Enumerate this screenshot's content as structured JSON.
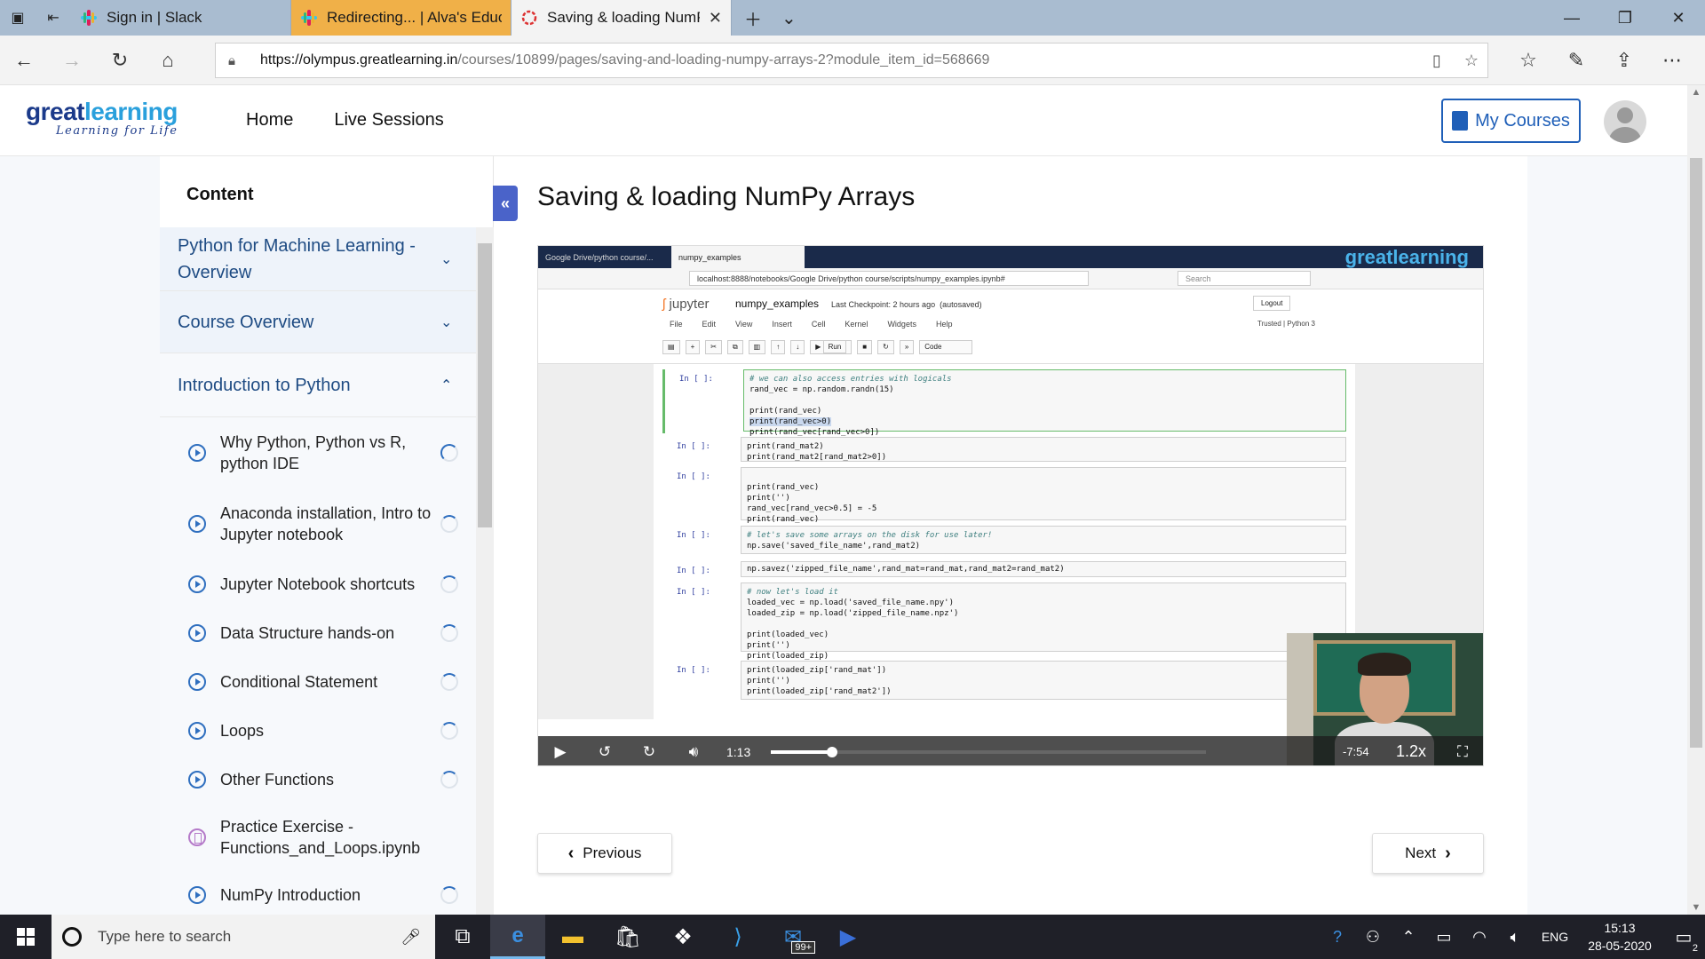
{
  "browser": {
    "tabs": [
      {
        "label": "Sign in | Slack",
        "state": "inactive"
      },
      {
        "label": "Redirecting... | Alva's Educat",
        "state": "inactive-highlight"
      },
      {
        "label": "Saving & loading NumP",
        "state": "active"
      }
    ],
    "url": {
      "host": "https://olympus.greatlearning.in",
      "path": "/courses/10899/pages/saving-and-loading-numpy-arrays-2?module_item_id=568669"
    },
    "icons": {
      "tab_actions": [
        "plus-icon",
        "chevron-down-icon"
      ],
      "window_controls": [
        "minimize-icon",
        "restore-icon",
        "close-icon"
      ],
      "nav": [
        "back-arrow-icon",
        "forward-arrow-icon",
        "refresh-icon",
        "home-icon"
      ],
      "right": [
        "favorites-icon",
        "pen-icon",
        "share-icon",
        "more-icon"
      ]
    }
  },
  "site": {
    "logo": {
      "great": "great",
      "learning": "learning",
      "tagline": "Learning for Life"
    },
    "nav": [
      "Home",
      "Live Sessions"
    ],
    "my_courses_label": "My Courses",
    "brand_color": "#1f5fb8"
  },
  "sidebar": {
    "title": "Content",
    "sections": [
      {
        "title": "Python for Machine Learning - Overview",
        "expanded": false
      },
      {
        "title": "Course Overview",
        "expanded": false
      },
      {
        "title": "Introduction to Python",
        "expanded": true
      }
    ],
    "lessons": [
      {
        "title": "Why Python, Python vs R, python IDE",
        "type": "video"
      },
      {
        "title": "Anaconda installation, Intro to Jupyter notebook",
        "type": "video"
      },
      {
        "title": "Jupyter Notebook shortcuts",
        "type": "video"
      },
      {
        "title": "Data Structure hands-on",
        "type": "video"
      },
      {
        "title": "Conditional Statement",
        "type": "video"
      },
      {
        "title": "Loops",
        "type": "video"
      },
      {
        "title": "Other Functions",
        "type": "video"
      },
      {
        "title": "Practice Exercise - Functions_and_Loops.ipynb",
        "type": "document"
      },
      {
        "title": "NumPy Introduction",
        "type": "video"
      }
    ]
  },
  "main": {
    "title": "Saving & loading NumPy Arrays",
    "collapse_label": "«",
    "prev_label": "Previous",
    "next_label": "Next"
  },
  "video": {
    "inner_tabs": [
      "Google Drive/python course/...",
      "numpy_examples"
    ],
    "inner_brand": "greatlearning",
    "inner_url": "localhost:8888/notebooks/Google Drive/python course/scripts/numpy_examples.ipynb#",
    "inner_search": "Search",
    "jupyter": {
      "logo": "jupyter",
      "notebook": "numpy_examples",
      "checkpoint": "Last Checkpoint: 2 hours ago",
      "autosave": "(autosaved)",
      "logout": "Logout",
      "trusted": "Trusted",
      "kernel": "Python 3",
      "menu": [
        "File",
        "Edit",
        "View",
        "Insert",
        "Cell",
        "Kernel",
        "Widgets",
        "Help"
      ],
      "run_label": "Run",
      "cell_type": "Code"
    },
    "cells": [
      {
        "prompt": "In [ ]:",
        "lines": [
          "# we can also access entries with logicals",
          "rand_vec = np.random.randn(15)",
          "",
          "print(rand_vec)",
          "print(rand_vec>0)",
          "print(rand_vec[rand_vec>0])"
        ]
      },
      {
        "prompt": "In [ ]:",
        "lines": [
          "print(rand_mat2)",
          "print(rand_mat2[rand_mat2>0])"
        ]
      },
      {
        "prompt": "In [ ]:",
        "lines": [
          "",
          "print(rand_vec)",
          "print('')",
          "rand_vec[rand_vec>0.5] = -5",
          "print(rand_vec)"
        ]
      },
      {
        "prompt": "In [ ]:",
        "lines": [
          "# let's save some arrays on the disk for use later!",
          "np.save('saved_file_name',rand_mat2)"
        ]
      },
      {
        "prompt": "In [ ]:",
        "lines": [
          "np.savez('zipped_file_name',rand_mat=rand_mat,rand_mat2=rand_mat2)"
        ]
      },
      {
        "prompt": "In [ ]:",
        "lines": [
          "# now let's load it",
          "loaded_vec = np.load('saved_file_name.npy')",
          "loaded_zip = np.load('zipped_file_name.npz')",
          "",
          "print(loaded_vec)",
          "print('')",
          "print(loaded_zip)"
        ]
      },
      {
        "prompt": "In [ ]:",
        "lines": [
          "print(loaded_zip['rand_mat'])",
          "print('')",
          "print(loaded_zip['rand_mat2'])"
        ]
      }
    ],
    "current_time": "1:13",
    "remaining_time": "-7:54",
    "speed": "1.2x",
    "progress_fraction": 0.14
  },
  "taskbar": {
    "search_placeholder": "Type here to search",
    "apps": [
      "task-view-icon",
      "edge-icon",
      "file-explorer-icon",
      "store-icon",
      "dropbox-icon",
      "vs-code-icon",
      "mail-icon",
      "powershell-icon"
    ],
    "mail_badge": "99+",
    "language": "ENG",
    "time": "15:13",
    "date": "28-05-2020",
    "notification_count": "2"
  }
}
